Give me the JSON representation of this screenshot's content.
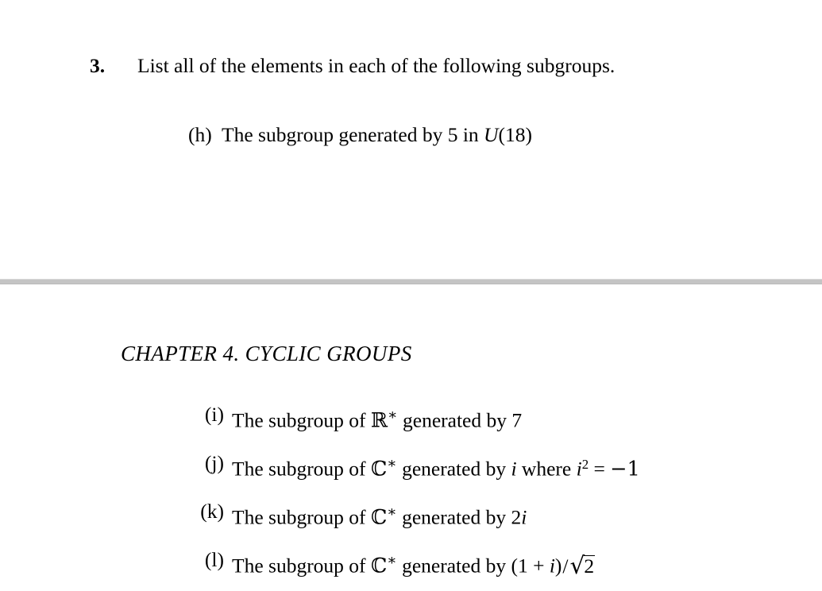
{
  "document": {
    "background_color": "#ffffff",
    "text_color": "#000000",
    "divider_color": "#c4c4c4"
  },
  "problem": {
    "number": "3.",
    "stem": "List all of the elements in each of the following subgroups.",
    "subitem_h": {
      "label": "(h)",
      "text_before": "The subgroup generated by 5 in ",
      "math_U": "U",
      "math_arg": "(18)",
      "full_text": "(h) The subgroup generated by 5 in U(18)"
    }
  },
  "chapter": {
    "heading": "CHAPTER 4. CYCLIC GROUPS"
  },
  "sublist": [
    {
      "label": "(i)",
      "prefix": "The subgroup of ",
      "set_symbol": "ℝ",
      "star": "∗",
      "middle": " generated by ",
      "value": "7",
      "suffix": "",
      "full_text": "(i) The subgroup of ℝ* generated by 7"
    },
    {
      "label": "(j)",
      "prefix": "The subgroup of ",
      "set_symbol": "ℂ",
      "star": "∗",
      "middle": " generated by ",
      "value": "i",
      "where_word": " where ",
      "where_base": "i",
      "where_exp": "2",
      "where_eq": " = ",
      "where_rhs": "−1",
      "full_text": "(j) The subgroup of ℂ* generated by i where i² = −1"
    },
    {
      "label": "(k)",
      "prefix": "The subgroup of ",
      "set_symbol": "ℂ",
      "star": "∗",
      "middle": " generated by ",
      "coefficient": "2",
      "value": "i",
      "full_text": "(k) The subgroup of ℂ* generated by 2i"
    },
    {
      "label": "(l)",
      "prefix": "The subgroup of ",
      "set_symbol": "ℂ",
      "star": "∗",
      "middle": " generated by ",
      "expr_open": "(1 + ",
      "expr_var": "i",
      "expr_close": ")",
      "slash": "/",
      "radical": "√",
      "radicand": "2",
      "full_text": "(l) The subgroup of ℂ* generated by (1 + i)/√2"
    }
  ]
}
